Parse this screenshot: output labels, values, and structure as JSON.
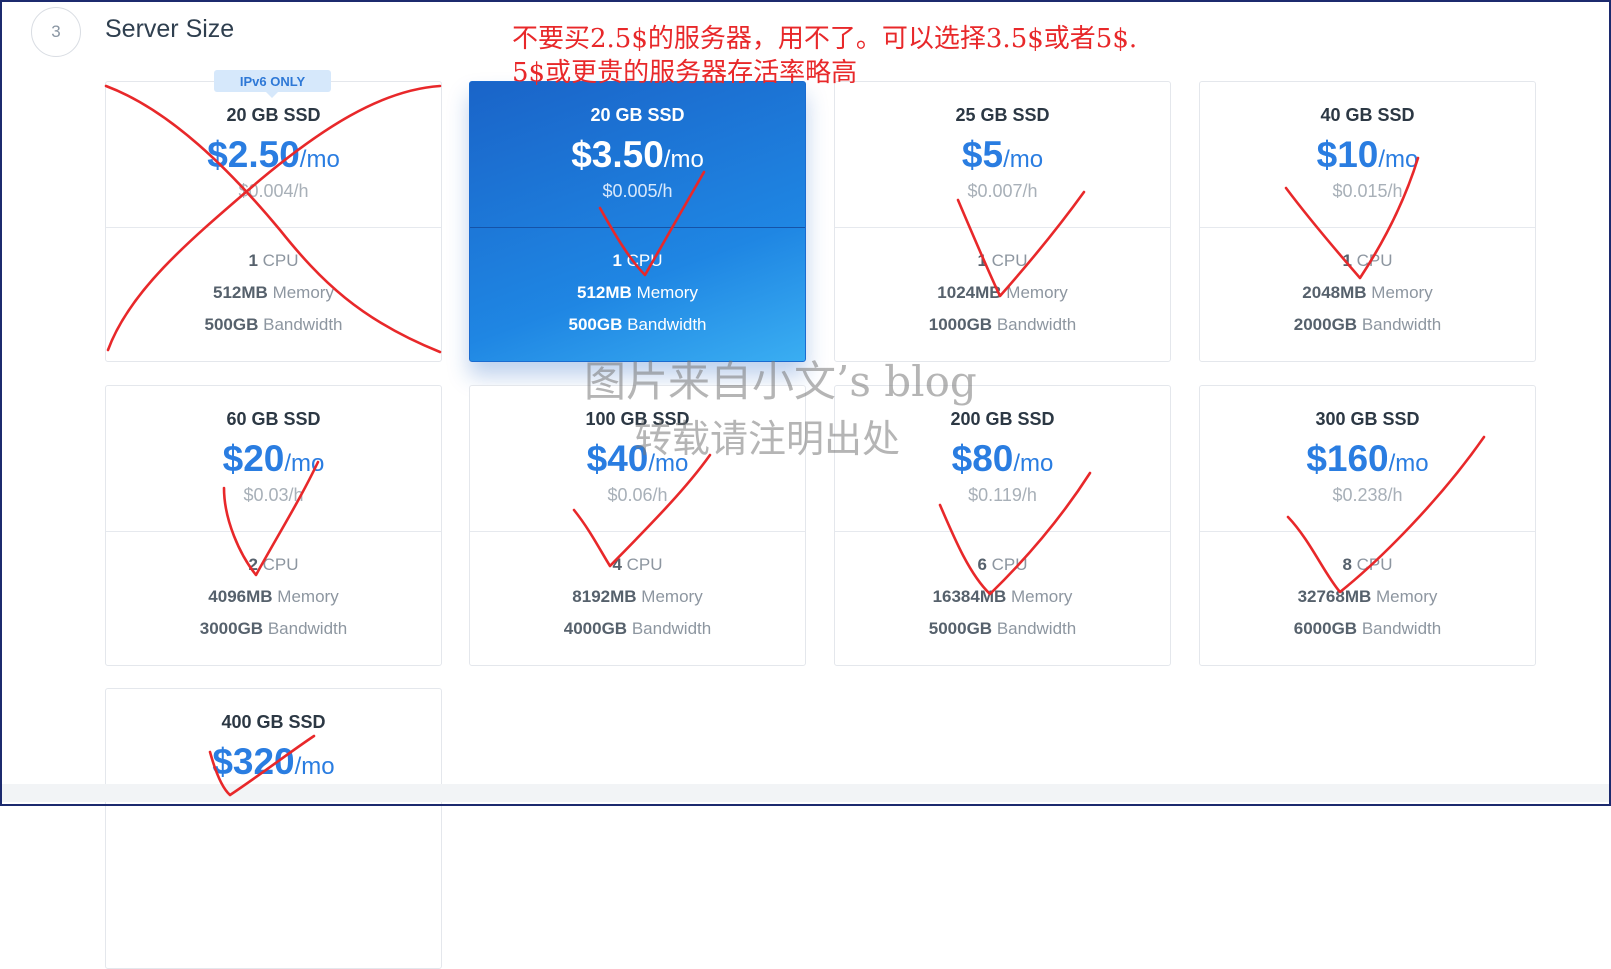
{
  "section": {
    "step_number": "3",
    "title": "Server Size"
  },
  "badge": {
    "label": "IPv6 ONLY"
  },
  "plans": [
    {
      "ssd": "20 GB SSD",
      "price": "$2.50",
      "period": "/mo",
      "hourly": "$0.004/h",
      "cpu_count": "1",
      "cpu_label": "CPU",
      "memory": "512MB",
      "memory_label": "Memory",
      "bandwidth": "500GB",
      "bandwidth_label": "Bandwidth"
    },
    {
      "ssd": "20 GB SSD",
      "price": "$3.50",
      "period": "/mo",
      "hourly": "$0.005/h",
      "cpu_count": "1",
      "cpu_label": "CPU",
      "memory": "512MB",
      "memory_label": "Memory",
      "bandwidth": "500GB",
      "bandwidth_label": "Bandwidth"
    },
    {
      "ssd": "25 GB SSD",
      "price": "$5",
      "period": "/mo",
      "hourly": "$0.007/h",
      "cpu_count": "1",
      "cpu_label": "CPU",
      "memory": "1024MB",
      "memory_label": "Memory",
      "bandwidth": "1000GB",
      "bandwidth_label": "Bandwidth"
    },
    {
      "ssd": "40 GB SSD",
      "price": "$10",
      "period": "/mo",
      "hourly": "$0.015/h",
      "cpu_count": "1",
      "cpu_label": "CPU",
      "memory": "2048MB",
      "memory_label": "Memory",
      "bandwidth": "2000GB",
      "bandwidth_label": "Bandwidth"
    },
    {
      "ssd": "60 GB SSD",
      "price": "$20",
      "period": "/mo",
      "hourly": "$0.03/h",
      "cpu_count": "2",
      "cpu_label": "CPU",
      "memory": "4096MB",
      "memory_label": "Memory",
      "bandwidth": "3000GB",
      "bandwidth_label": "Bandwidth"
    },
    {
      "ssd": "100 GB SSD",
      "price": "$40",
      "period": "/mo",
      "hourly": "$0.06/h",
      "cpu_count": "4",
      "cpu_label": "CPU",
      "memory": "8192MB",
      "memory_label": "Memory",
      "bandwidth": "4000GB",
      "bandwidth_label": "Bandwidth"
    },
    {
      "ssd": "200 GB SSD",
      "price": "$80",
      "period": "/mo",
      "hourly": "$0.119/h",
      "cpu_count": "6",
      "cpu_label": "CPU",
      "memory": "16384MB",
      "memory_label": "Memory",
      "bandwidth": "5000GB",
      "bandwidth_label": "Bandwidth"
    },
    {
      "ssd": "300 GB SSD",
      "price": "$160",
      "period": "/mo",
      "hourly": "$0.238/h",
      "cpu_count": "8",
      "cpu_label": "CPU",
      "memory": "32768MB",
      "memory_label": "Memory",
      "bandwidth": "6000GB",
      "bandwidth_label": "Bandwidth"
    },
    {
      "ssd": "400 GB SSD",
      "price": "$320",
      "period": "/mo"
    }
  ],
  "annotations": {
    "note_line1": "不要买2.5$的服务器，用不了。可以选择3.5$或者5$.",
    "note_line2": "5$或更贵的服务器存活率略高",
    "watermark_line1": "图片来自小文’s blog",
    "watermark_line2": "转载请注明出处",
    "ink_color": "#e8282a"
  },
  "colors": {
    "accent": "#2a7de1",
    "selected_gradient_start": "#1a64c8",
    "selected_gradient_end": "#3aaef2"
  }
}
